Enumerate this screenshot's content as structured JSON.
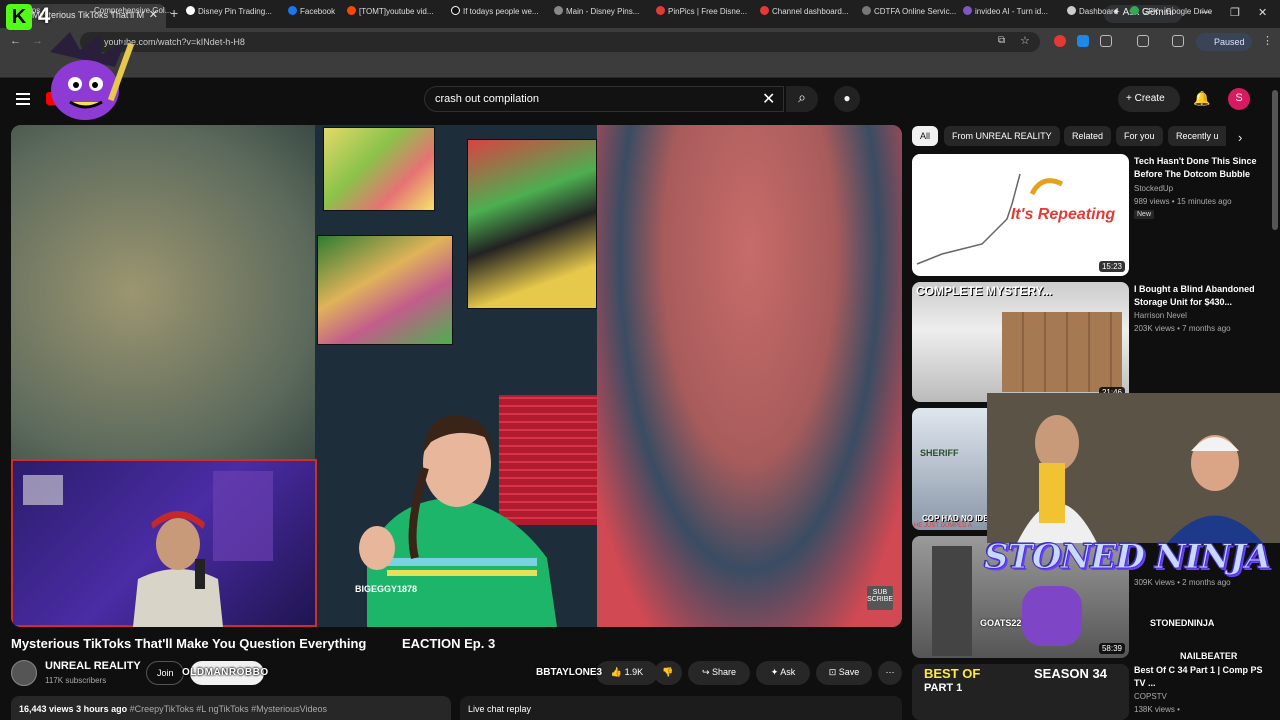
{
  "browser": {
    "tab_title": "Mysterious TikToks That'll M",
    "url": "youtube.com/watch?v=kINdet-h-H8",
    "ask_gemini": "Ask Gemini",
    "paused": "Paused",
    "bookmarks": [
      "Apps",
      "Comprehensive Gol...",
      "Disney Pin Trading...",
      "Facebook",
      "[TOMT]youtube vid...",
      "If todays people we...",
      "Main - Disney Pins...",
      "PinPics | Free Disne...",
      "Channel dashboard...",
      "CDTFA Online Servic...",
      "invideo AI - Turn id...",
      "Dashboard",
      "GFX - Google Drive"
    ]
  },
  "header": {
    "search_value": "crash out compilation",
    "create_label": "Create",
    "avatar_letter": "S"
  },
  "video": {
    "title": "Mysterious TikToks That'll Make You Question Everything",
    "title_suffix": "EACTION Ep. 3",
    "sub_logo": "SUB SCRIBE",
    "overlay_name": "BIGEGGY1878"
  },
  "channel": {
    "name": "UNREAL REALITY",
    "subscribers": "117K subscribers",
    "join_label": "Join",
    "overlay_name": "OLDMANROBBO"
  },
  "actions": {
    "likes": "1.9K",
    "share_label": "Share",
    "ask_label": "Ask",
    "save_label": "Save",
    "overlay_name": "BBTAYLONE3"
  },
  "description": {
    "views": "16,443 views",
    "age": "3 hours ago",
    "tags": "#CreepyTikToks #L    ngTikToks #MysteriousVideos",
    "live_chat_replay": "Live chat replay"
  },
  "chips": [
    "All",
    "From UNREAL REALITY",
    "Related",
    "For you",
    "Recently u"
  ],
  "recommendations": [
    {
      "title": "Tech Hasn't Done This Since Before The Dotcom Bubble",
      "channel": "StockedUp",
      "meta": "989 views • 15 minutes ago",
      "badge": "New",
      "duration": "15:23",
      "thumb_text": "It's Repeating"
    },
    {
      "title": "I Bought a Blind Abandoned Storage Unit for $430...",
      "channel": "Harrison Nevel",
      "meta": "203K views • 7 months ago",
      "duration": "21:46",
      "thumb_text": "COMPLETE MYSTERY..."
    },
    {
      "title": "",
      "channel": "",
      "meta": "",
      "thumb_text": "SHERIFF",
      "thumb_text2": "COP HAD NO IDE",
      "thumb_text3": "HE JUST DUMPED A"
    },
    {
      "title": "",
      "channel": "",
      "meta": "309K views • 2 months ago",
      "duration": "58:39"
    },
    {
      "title": "Best Of C    34 Part 1 | Comp    PS TV ...",
      "channel": "COPSTV",
      "meta": "138K views •",
      "thumb_text": "BEST OF",
      "thumb_text2": "SEASON 34",
      "thumb_text3": "PART 1"
    }
  ],
  "overlays": {
    "stoned_ninja": "STONED NINJA",
    "stoned_name": "STONEDNINJA",
    "nailbeater": "NAILBEATER",
    "goats": "GOATS22",
    "kick_num": "4"
  },
  "colors": {
    "bg": "#0f0f0f",
    "kick_green": "#53fc18",
    "cam_border": "#d12d2d",
    "youtube_red": "#ff0000"
  }
}
